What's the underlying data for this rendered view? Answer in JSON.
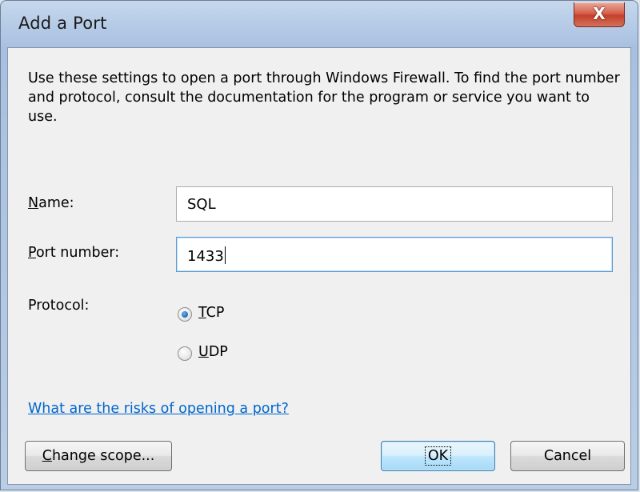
{
  "window": {
    "title": "Add a Port",
    "close_glyph": "X"
  },
  "description": "Use these settings to open a port through Windows Firewall. To find the port number and protocol, consult the documentation for the program or service you want to use.",
  "name_field": {
    "label_access_key": "N",
    "label_rest": "ame:",
    "value": "SQL"
  },
  "port_field": {
    "label_access_key": "P",
    "label_rest": "ort number:",
    "value": "1433"
  },
  "protocol": {
    "label": "Protocol:",
    "options": [
      {
        "access_key": "T",
        "rest": "CP",
        "selected": true
      },
      {
        "access_key": "U",
        "rest": "DP",
        "selected": false
      }
    ]
  },
  "help_link": "What are the risks of opening a port?",
  "buttons": {
    "change_scope_access_key": "C",
    "change_scope_rest": "hange scope...",
    "ok": "OK",
    "cancel": "Cancel"
  },
  "colors": {
    "link": "#0066cc",
    "default_button_border": "#3c7fb1",
    "close_button": "#c4402a"
  }
}
